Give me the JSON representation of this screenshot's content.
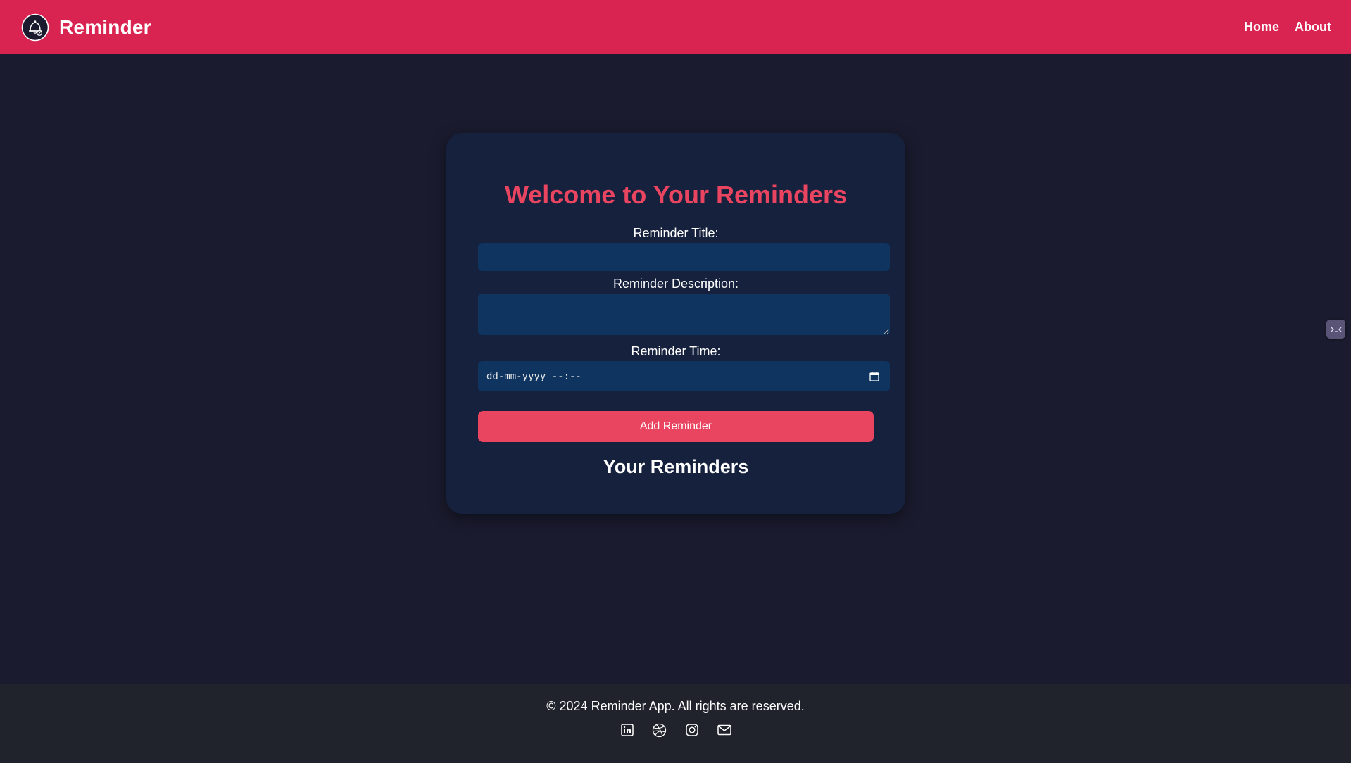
{
  "nav": {
    "brand": "Reminder",
    "links": [
      "Home",
      "About"
    ]
  },
  "main": {
    "title": "Welcome to Your Reminders",
    "title_label": "Reminder Title:",
    "description_label": "Reminder Description:",
    "time_label": "Reminder Time:",
    "time_placeholder": "dd-mm-yyyy --:--",
    "add_button": "Add Reminder",
    "list_title": "Your Reminders"
  },
  "footer": {
    "text": "© 2024 Reminder App. All rights are reserved.",
    "social_icons": [
      "linkedin-icon",
      "dribbble-icon",
      "instagram-icon",
      "mail-icon"
    ]
  },
  "colors": {
    "navbar": "#d92350",
    "accent": "#e94560",
    "background": "#1a1b2e",
    "card": "#16213e",
    "input": "#0f3460",
    "footer": "#20232b"
  }
}
